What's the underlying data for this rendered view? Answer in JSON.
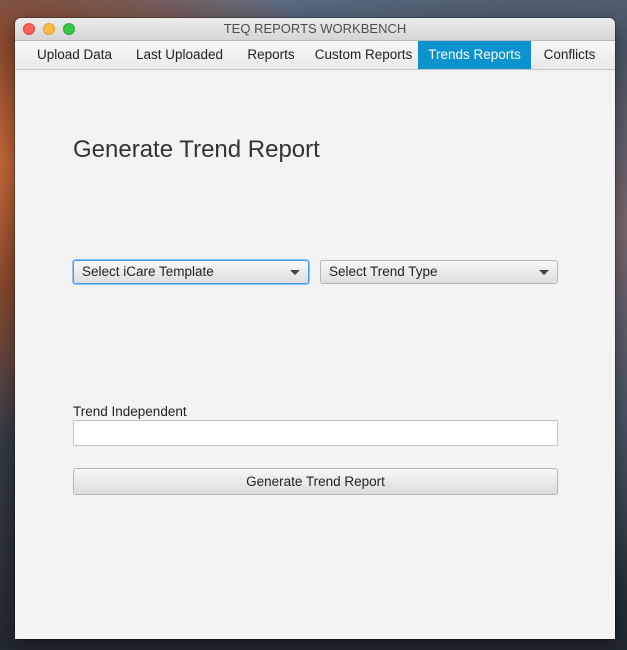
{
  "window": {
    "title": "TEQ REPORTS WORKBENCH"
  },
  "tabs": [
    {
      "label": "Upload Data",
      "selected": false
    },
    {
      "label": "Last Uploaded",
      "selected": false
    },
    {
      "label": "Reports",
      "selected": false
    },
    {
      "label": "Custom Reports",
      "selected": false
    },
    {
      "label": "Trends Reports",
      "selected": true
    },
    {
      "label": "Conflicts",
      "selected": false
    }
  ],
  "main": {
    "heading": "Generate Trend Report",
    "template_select": {
      "value": "Select iCare Template",
      "focused": true
    },
    "trend_type_select": {
      "value": "Select Trend Type",
      "focused": false
    },
    "trend_independent": {
      "label": "Trend Independent",
      "value": ""
    },
    "generate_button_label": "Generate Trend Report"
  },
  "colors": {
    "selected_tab": "#0b93d0",
    "focus_ring": "#3b99fc",
    "window_bg": "#f3f3f3"
  },
  "icons": {
    "close": "traffic-light-close-icon",
    "minimize": "traffic-light-minimize-icon",
    "maximize": "traffic-light-maximize-icon",
    "dropdown": "chevron-down-icon"
  }
}
